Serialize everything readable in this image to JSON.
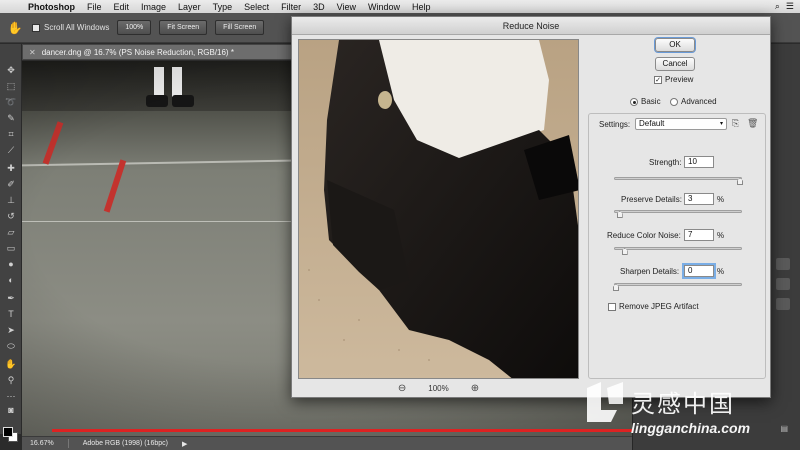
{
  "menubar": {
    "app": "Photoshop",
    "items": [
      "File",
      "Edit",
      "Image",
      "Layer",
      "Type",
      "Select",
      "Filter",
      "3D",
      "View",
      "Window",
      "Help"
    ]
  },
  "options_bar": {
    "scroll_all_windows": "Scroll All Windows",
    "zoom_btn": "100%",
    "fit_btn": "Fit Screen",
    "fill_btn": "Fill Screen"
  },
  "document": {
    "tab_title": "dancer.dng @ 16.7% (PS Noise Reduction, RGB/16) *"
  },
  "status": {
    "zoom": "16.67%",
    "profile": "Adobe RGB (1998) (16bpc)"
  },
  "dialog": {
    "title": "Reduce Noise",
    "ok": "OK",
    "cancel": "Cancel",
    "preview_label": "Preview",
    "preview_checked": true,
    "mode_basic": "Basic",
    "mode_advanced": "Advanced",
    "mode_selected": "Basic",
    "settings_label": "Settings:",
    "settings_value": "Default",
    "zoom_value": "100%",
    "strength": {
      "label": "Strength:",
      "value": "10",
      "max": 10
    },
    "preserve": {
      "label": "Preserve Details:",
      "value": "3",
      "unit": "%",
      "max": 100
    },
    "color_noise": {
      "label": "Reduce Color Noise:",
      "value": "7",
      "unit": "%",
      "max": 100
    },
    "sharpen": {
      "label": "Sharpen Details:",
      "value": "0",
      "unit": "%",
      "max": 100
    },
    "jpeg_label": "Remove JPEG Artifact",
    "jpeg_checked": false
  },
  "watermark": {
    "cn": "灵感中国",
    "en": "lingganchina.com"
  },
  "colors": {
    "accent_focus": "#7aaee6",
    "stage_red": "#c3332e"
  }
}
